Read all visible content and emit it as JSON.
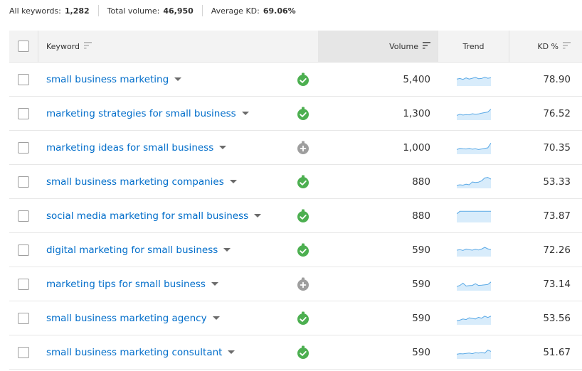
{
  "summary": {
    "all_keywords_label": "All keywords:",
    "all_keywords_value": "1,282",
    "total_volume_label": "Total volume:",
    "total_volume_value": "46,950",
    "average_kd_label": "Average KD:",
    "average_kd_value": "69.06%"
  },
  "headers": {
    "keyword": "Keyword",
    "volume": "Volume",
    "trend": "Trend",
    "kd": "KD %"
  },
  "colors": {
    "link": "#006dca",
    "status_ok": "#4caf50",
    "status_neutral": "#9e9e9e",
    "trend_line": "#5aa9e6",
    "trend_fill": "#d8ecfb"
  },
  "rows": [
    {
      "keyword": "small business marketing",
      "status": "check",
      "volume": "5,400",
      "kd": "78.90",
      "trend": [
        0.55,
        0.6,
        0.52,
        0.65,
        0.55,
        0.62,
        0.7,
        0.58,
        0.6,
        0.72,
        0.62,
        0.66
      ]
    },
    {
      "keyword": "marketing strategies for small business",
      "status": "check",
      "volume": "1,300",
      "kd": "76.52",
      "trend": [
        0.35,
        0.45,
        0.38,
        0.42,
        0.4,
        0.5,
        0.45,
        0.48,
        0.55,
        0.6,
        0.65,
        0.9
      ]
    },
    {
      "keyword": "marketing ideas for small business",
      "status": "plus",
      "volume": "1,000",
      "kd": "70.35",
      "trend": [
        0.35,
        0.45,
        0.42,
        0.4,
        0.45,
        0.38,
        0.42,
        0.35,
        0.4,
        0.45,
        0.5,
        0.92
      ]
    },
    {
      "keyword": "small business marketing companies",
      "status": "check",
      "volume": "880",
      "kd": "53.33",
      "trend": [
        0.2,
        0.25,
        0.22,
        0.3,
        0.25,
        0.5,
        0.45,
        0.48,
        0.6,
        0.85,
        0.9,
        0.75
      ]
    },
    {
      "keyword": "social media marketing for small business",
      "status": "check",
      "volume": "880",
      "kd": "73.87",
      "trend": [
        0.7,
        0.92,
        0.92,
        0.92,
        0.92,
        0.92,
        0.92,
        0.92,
        0.92,
        0.92,
        0.92,
        0.92
      ]
    },
    {
      "keyword": "digital marketing for small business",
      "status": "check",
      "volume": "590",
      "kd": "72.26",
      "trend": [
        0.5,
        0.55,
        0.48,
        0.6,
        0.55,
        0.5,
        0.58,
        0.52,
        0.6,
        0.75,
        0.62,
        0.55
      ]
    },
    {
      "keyword": "marketing tips for small business",
      "status": "plus",
      "volume": "590",
      "kd": "73.14",
      "trend": [
        0.3,
        0.4,
        0.6,
        0.35,
        0.38,
        0.4,
        0.55,
        0.4,
        0.42,
        0.45,
        0.48,
        0.7
      ]
    },
    {
      "keyword": "small business marketing agency",
      "status": "check",
      "volume": "590",
      "kd": "53.56",
      "trend": [
        0.3,
        0.35,
        0.45,
        0.4,
        0.55,
        0.5,
        0.45,
        0.6,
        0.52,
        0.7,
        0.58,
        0.7
      ]
    },
    {
      "keyword": "small business marketing consultant",
      "status": "check",
      "volume": "590",
      "kd": "51.67",
      "trend": [
        0.35,
        0.4,
        0.38,
        0.42,
        0.45,
        0.4,
        0.48,
        0.45,
        0.5,
        0.45,
        0.72,
        0.6
      ]
    }
  ]
}
